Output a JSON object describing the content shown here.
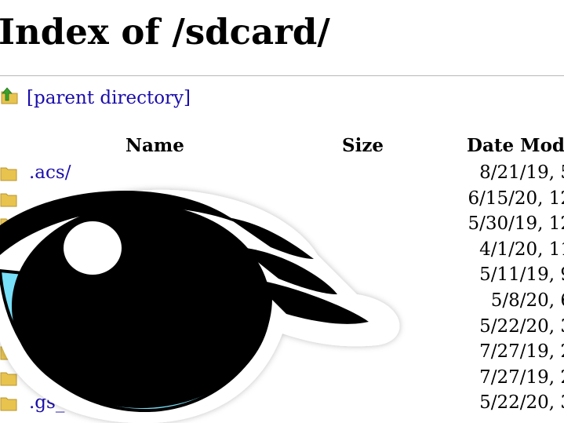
{
  "page": {
    "title": "Index of /sdcard/",
    "parent_link": "[parent directory]"
  },
  "columns": {
    "name": "Name",
    "size": "Size",
    "date": "Date Modi"
  },
  "entries": [
    {
      "name": ".acs/",
      "size": "",
      "date": "8/21/19, 5"
    },
    {
      "name": "",
      "size": "",
      "date": "6/15/20, 12"
    },
    {
      "name": "",
      "size": "",
      "date": "5/30/19, 12"
    },
    {
      "name": "",
      "size": "",
      "date": "4/1/20, 11"
    },
    {
      "name": "",
      "size": "",
      "date": "5/11/19, 9"
    },
    {
      "name": "",
      "size": "",
      "date": "5/8/20, 6"
    },
    {
      "name": "",
      "size": "",
      "date": "5/22/20, 3"
    },
    {
      "name": "",
      "size": "",
      "date": "7/27/19, 2"
    },
    {
      "name": "",
      "size": "",
      "date": "7/27/19, 2"
    },
    {
      "name": ".gs_",
      "size": "",
      "date": "5/22/20, 3"
    }
  ],
  "icons": {
    "parent": "up-arrow-folder-icon",
    "folder": "folder-icon",
    "overlay": "eye-logo-icon"
  },
  "colors": {
    "link": "#1a0dab",
    "folder": "#e8c44f",
    "parent_arrow": "#3aa12b",
    "eye_iris": "#78dff8",
    "eye_outline": "#000000"
  }
}
